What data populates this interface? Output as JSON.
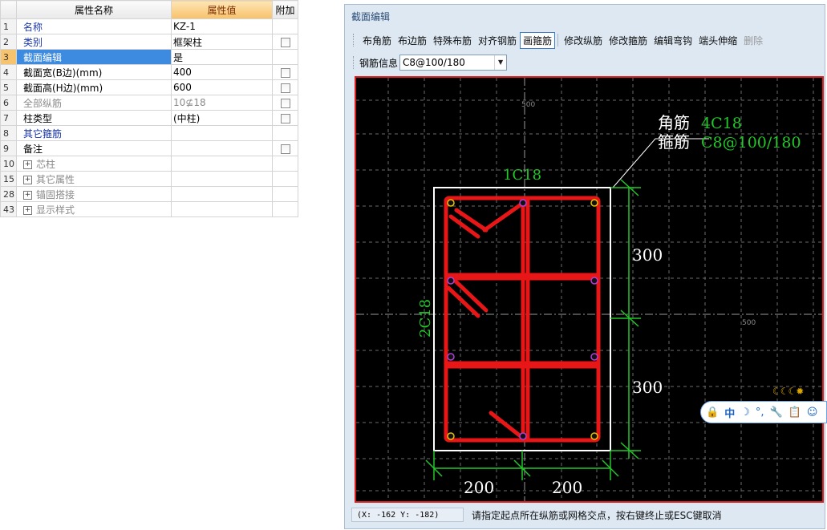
{
  "prop_table": {
    "headers": {
      "name": "属性名称",
      "value": "属性值",
      "extra": "附加"
    },
    "rows": [
      {
        "idx": "1",
        "name": "名称",
        "value": "KZ-1",
        "style": "blue",
        "check": false
      },
      {
        "idx": "2",
        "name": "类别",
        "value": "框架柱",
        "style": "blue",
        "check": true
      },
      {
        "idx": "3",
        "name": "截面编辑",
        "value": "是",
        "style": "blue",
        "check": false,
        "selected": true
      },
      {
        "idx": "4",
        "name": "截面宽(B边)(mm)",
        "value": "400",
        "style": "plain",
        "check": true
      },
      {
        "idx": "5",
        "name": "截面高(H边)(mm)",
        "value": "600",
        "style": "plain",
        "check": true
      },
      {
        "idx": "6",
        "name": "全部纵筋",
        "value": "10⊈18",
        "style": "gray",
        "check": true
      },
      {
        "idx": "7",
        "name": "柱类型",
        "value": "(中柱)",
        "style": "plain",
        "check": true
      },
      {
        "idx": "8",
        "name": "其它箍筋",
        "value": "",
        "style": "blue",
        "check": false
      },
      {
        "idx": "9",
        "name": "备注",
        "value": "",
        "style": "plain",
        "check": true
      },
      {
        "idx": "10",
        "name": "芯柱",
        "value": "",
        "style": "gray",
        "check": false,
        "expander": true
      },
      {
        "idx": "15",
        "name": "其它属性",
        "value": "",
        "style": "gray",
        "check": false,
        "expander": true
      },
      {
        "idx": "28",
        "name": "锚固搭接",
        "value": "",
        "style": "gray",
        "check": false,
        "expander": true
      },
      {
        "idx": "43",
        "name": "显示样式",
        "value": "",
        "style": "gray",
        "check": false,
        "expander": true
      }
    ]
  },
  "panel": {
    "title": "截面编辑",
    "toolbar": {
      "buttons": [
        "布角筋",
        "布边筋",
        "特殊布筋",
        "对齐钢筋",
        "画箍筋"
      ],
      "buttons2": [
        "修改纵筋",
        "修改箍筋",
        "编辑弯钩",
        "端头伸缩",
        "删除"
      ]
    },
    "rebar_info": {
      "label": "钢筋信息",
      "value": "C8@100/180"
    }
  },
  "drawing": {
    "corner_label": "角筋",
    "corner_value": "4C18",
    "stirrup_label": "箍筋",
    "stirrup_value": "C8@100/180",
    "top_label": "1C18",
    "side_label": "2C18",
    "dim_right_1": "300",
    "dim_right_2": "300",
    "dim_bottom_1": "200",
    "dim_bottom_2": "200",
    "grid_label_top": "500",
    "grid_label_right": "500"
  },
  "status": {
    "coord": "(X: -162 Y: -182)",
    "hint": "请指定起点所在纵筋或网格交点，按右键终止或ESC键取消"
  },
  "ime": {
    "moons": "☾☾☾✹",
    "items": [
      "🔒",
      "中",
      "☽",
      "°,",
      "🔧",
      "📋",
      "☺"
    ]
  }
}
